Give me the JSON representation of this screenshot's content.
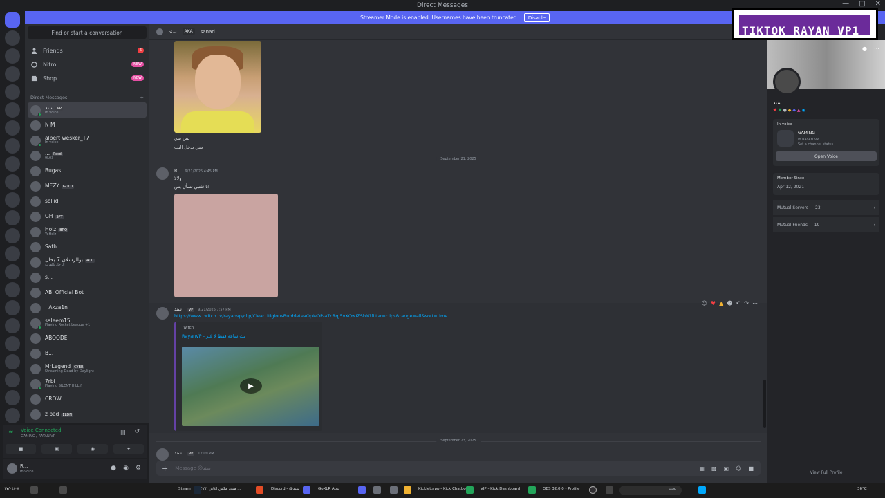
{
  "window": {
    "title": "Direct Messages"
  },
  "banner": {
    "text": "Streamer Mode is enabled. Usernames have been truncated.",
    "disable_label": "Disable"
  },
  "overlay": {
    "text": "TIKTOK RAYAN_VP1"
  },
  "sidebar": {
    "search_label": "Find or start a conversation",
    "nav": [
      {
        "label": "Friends",
        "badge": "6"
      },
      {
        "label": "Nitro",
        "badge": "NEW"
      },
      {
        "label": "Shop",
        "badge": "NEW"
      }
    ],
    "dm_header": "Direct Messages",
    "dm_add": "+",
    "dms": [
      {
        "name": "سند",
        "tag": "VP",
        "sub": "In voice"
      },
      {
        "name": "N M",
        "tag": "",
        "sub": ""
      },
      {
        "name": "albert wesker_T7",
        "tag": "",
        "sub": "In voice"
      },
      {
        "name": "...",
        "tag": "Pesd",
        "sub": "9L03"
      },
      {
        "name": "Bugas",
        "tag": "",
        "sub": ""
      },
      {
        "name": "MEZY",
        "tag": "GOLD",
        "sub": ""
      },
      {
        "name": "sollid",
        "tag": "",
        "sub": ""
      },
      {
        "name": "GH",
        "tag": "SPT",
        "sub": ""
      },
      {
        "name": "Holz",
        "tag": "BRQ",
        "sub": "YeHolz"
      },
      {
        "name": "Sath",
        "tag": "",
        "sub": ""
      },
      {
        "name": "بوالرسلان 7 بخال",
        "tag": "ACU",
        "sub": "الرجل بالقرب"
      },
      {
        "name": "s...",
        "tag": "",
        "sub": ""
      },
      {
        "name": "ABI Official Bot",
        "tag": "",
        "sub": ""
      },
      {
        "name": "! Akza1n",
        "tag": "",
        "sub": ""
      },
      {
        "name": "saleem15",
        "tag": "",
        "sub": "Playing Rocket League +1"
      },
      {
        "name": "ABOODE",
        "tag": "",
        "sub": ""
      },
      {
        "name": "B...",
        "tag": "",
        "sub": ""
      },
      {
        "name": "MrLegend",
        "tag": "CYBR",
        "sub": "Streaming Dead by Daylight"
      },
      {
        "name": "7rbi",
        "tag": "",
        "sub": "Playing SILENT HILL f"
      },
      {
        "name": "CROW",
        "tag": "",
        "sub": ""
      },
      {
        "name": "z bad",
        "tag": "ELDN",
        "sub": ""
      }
    ]
  },
  "voice": {
    "status": "Voice Connected",
    "channel": "GAMING / RAYAN VP"
  },
  "user": {
    "name": "R...",
    "status": "In voice"
  },
  "chat": {
    "header_name": "سند",
    "aka_label": "AKA",
    "aka_value": "sanad",
    "msg1_line1": "بس بس",
    "msg1_line2": "شي يدخل النت",
    "divider1": "September 21, 2025",
    "msg2_author": "R...",
    "msg2_time": "9/21/2025 4:45 PM",
    "msg2_line1": "ولالا",
    "msg2_line2": "انا قلتبي تسأل بس",
    "msg3_author": "سند",
    "msg3_tag": "VP",
    "msg3_time": "9/21/2025 7:57 PM",
    "msg3_link": "https://www.twitch.tv/rayanvp/clip/ClearLitigiousBubbleteaOpieOP-a7cRqJ5vXQwIZSbN?filter=clips&range=all&sort=time",
    "embed_provider": "Twitch",
    "embed_title": "RayanVP - بث ساعة فقط لا غير",
    "divider2": "September 23, 2025",
    "msg4_author": "سند",
    "msg4_tag": "VP",
    "msg4_time": "12:09 PM",
    "composer_placeholder": "Message @سند"
  },
  "profile": {
    "name": "سند",
    "in_voice_label": "In voice",
    "voice_channel": "GAMING",
    "voice_server": "in RAYAN VP",
    "voice_status": "Set a channel status",
    "open_voice_label": "Open Voice",
    "member_since_label": "Member Since",
    "member_since": "Apr 12, 2021",
    "mutual_servers": "Mutual Servers — 23",
    "mutual_friends": "Mutual Friends — 19",
    "view_full": "View Full Profile"
  },
  "taskbar": {
    "items": [
      "Steam",
      "(٩٦) ميني مكس اغاني ...",
      "Discord - @سند",
      "GoXLR App",
      "Kicklet.app - Kick Chatbot",
      "VIP - Kick Dashboard",
      "OBS 32.0.0 - Profile",
      "بحث"
    ],
    "weather": "36°C",
    "time": "١٧/٠٤/٠٧"
  },
  "colors": {
    "accent": "#5865f2",
    "online": "#23a55a",
    "link": "#00a8fc"
  }
}
